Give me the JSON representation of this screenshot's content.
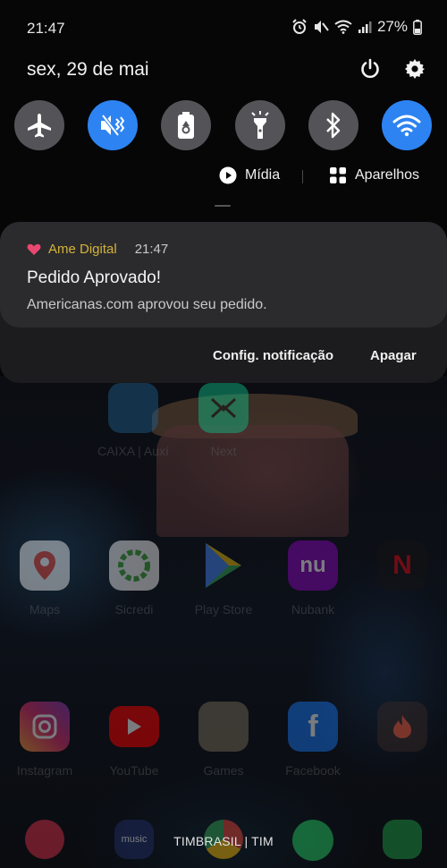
{
  "status_bar": {
    "time": "21:47",
    "battery": "27%"
  },
  "panel": {
    "date": "sex, 29 de mai",
    "toggles": [
      {
        "name": "airplane-mode",
        "icon": "airplane-icon",
        "active": false
      },
      {
        "name": "mute",
        "icon": "mute-vibrate-icon",
        "active": true
      },
      {
        "name": "power-saving",
        "icon": "battery-recycle-icon",
        "active": false
      },
      {
        "name": "flashlight",
        "icon": "flashlight-icon",
        "active": false
      },
      {
        "name": "bluetooth",
        "icon": "bluetooth-icon",
        "active": false
      },
      {
        "name": "wifi",
        "icon": "wifi-icon",
        "active": true
      }
    ],
    "media_label": "Mídia",
    "devices_label": "Aparelhos"
  },
  "notification": {
    "app_name": "Ame Digital",
    "time": "21:47",
    "title": "Pedido Aprovado!",
    "body": "Americanas.com aprovou seu pedido.",
    "settings_action": "Config. notificação",
    "clear_action": "Apagar"
  },
  "home_apps": [
    {
      "label": "CAIXA | Auxí"
    },
    {
      "label": "Next"
    },
    {
      "label": "Maps"
    },
    {
      "label": "Sicredi"
    },
    {
      "label": "Play Store"
    },
    {
      "label": "Nubank"
    },
    {
      "label": "Instagram"
    },
    {
      "label": "YouTube"
    },
    {
      "label": "Games"
    },
    {
      "label": "Facebook"
    }
  ],
  "dock": {
    "music_label": "music"
  },
  "carrier": "TIMBRASIL | TIM",
  "colors": {
    "accent": "#2d83f1",
    "app_name": "#d4b23a",
    "heart": "#e84870"
  }
}
